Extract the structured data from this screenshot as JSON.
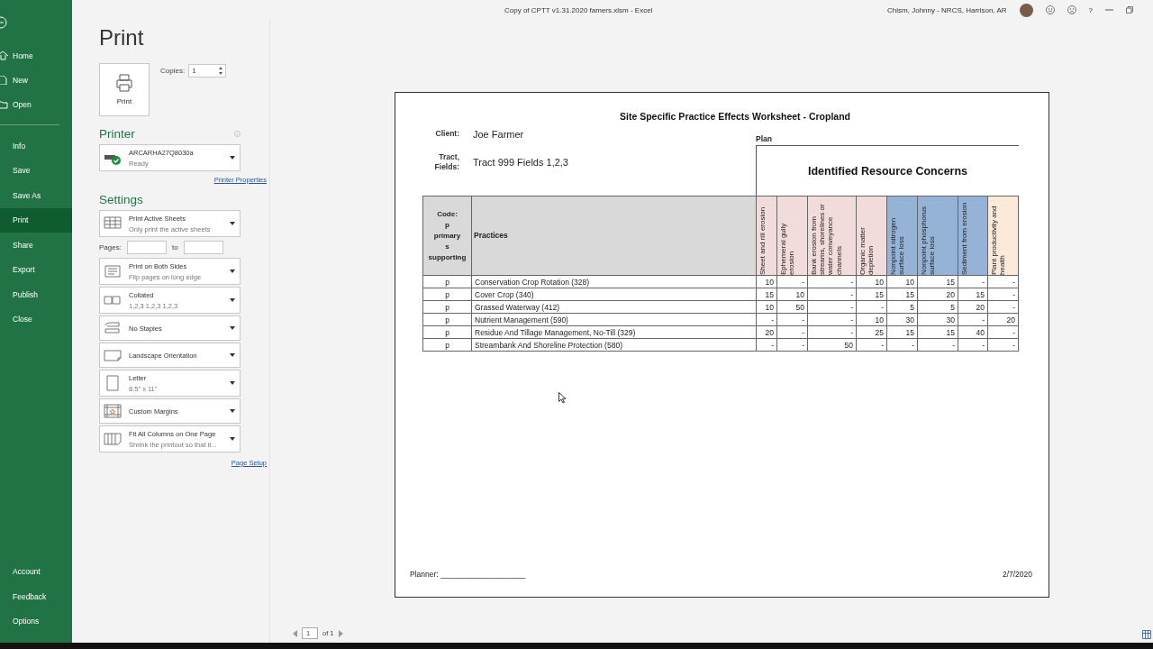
{
  "title_bar": {
    "title": "Copy of CPTT v1.31.2020 famers.xlsm  -  Excel",
    "user": "Chism, Johnny - NRCS, Harrison, AR",
    "help": "?"
  },
  "nav": {
    "items": [
      {
        "label": "Home",
        "kind": "icon",
        "selected": false
      },
      {
        "label": "New",
        "kind": "icon",
        "selected": false
      },
      {
        "label": "Open",
        "kind": "icon",
        "selected": false
      },
      {
        "label": "Info",
        "kind": "plain",
        "selected": false
      },
      {
        "label": "Save",
        "kind": "plain",
        "selected": false
      },
      {
        "label": "Save As",
        "kind": "plain",
        "selected": false
      },
      {
        "label": "Print",
        "kind": "plain",
        "selected": true
      },
      {
        "label": "Share",
        "kind": "plain",
        "selected": false
      },
      {
        "label": "Export",
        "kind": "plain",
        "selected": false
      },
      {
        "label": "Publish",
        "kind": "plain",
        "selected": false
      },
      {
        "label": "Close",
        "kind": "plain",
        "selected": false
      },
      {
        "label": "Account",
        "kind": "footer",
        "selected": false
      },
      {
        "label": "Feedback",
        "kind": "footer",
        "selected": false
      },
      {
        "label": "Options",
        "kind": "footer",
        "selected": false
      }
    ]
  },
  "print_panel": {
    "heading": "Print",
    "print_button": "Print",
    "copies_label": "Copies:",
    "copies": "1",
    "printer_heading": "Printer",
    "printer_name": "ARCARHA27Q8030a",
    "printer_status": "Ready",
    "printer_properties": "Printer Properties",
    "settings_heading": "Settings",
    "settings": [
      {
        "kind": "sheets",
        "title": "Print Active Sheets",
        "subtitle": "Only print the active sheets"
      },
      {
        "kind": "pages",
        "label": "Pages:",
        "to": "to"
      },
      {
        "kind": "duplex",
        "title": "Print on Both Sides",
        "subtitle": "Flip pages on long edge"
      },
      {
        "kind": "collate",
        "title": "Collated",
        "subtitle": "1,2,3    1,2,3    1,2,3"
      },
      {
        "kind": "staples",
        "title": "No Staples"
      },
      {
        "kind": "orientation",
        "title": "Landscape Orientation"
      },
      {
        "kind": "paper",
        "title": "Letter",
        "subtitle": "8.5\" x 11\""
      },
      {
        "kind": "margins",
        "title": "Custom Margins"
      },
      {
        "kind": "scaling",
        "title": "Fit All Columns on One Page",
        "subtitle": "Shrink the printout so that it..."
      }
    ],
    "page_setup": "Page Setup"
  },
  "worksheet": {
    "title": "Site Specific Practice Effects Worksheet - Cropland",
    "client_label": "Client:",
    "client": "Joe Farmer",
    "tract_label": "Tract,\nFields:",
    "tract": "Tract 999 Fields 1,2,3",
    "plan_label": "Plan",
    "concerns_heading": "Identified Resource Concerns",
    "code_header": "Code:\np\nprimary\ns\nsupporting",
    "practices_header": "Practices",
    "columns": [
      {
        "name": "Sheet and rill erosion",
        "color": "#f2dcdb"
      },
      {
        "name": "Ephemeral gully erosion",
        "color": "#f2dcdb"
      },
      {
        "name": "Bank erosion from streams, shorelines or water conveyance channels",
        "color": "#f2dcdb"
      },
      {
        "name": "Organic matter depletion",
        "color": "#f2dcdb"
      },
      {
        "name": "Nonpoint nitrogen surface loss",
        "color": "#95b3d7"
      },
      {
        "name": "Nonpoint phosphorus surface loss",
        "color": "#95b3d7"
      },
      {
        "name": "Sediment from erosion",
        "color": "#95b3d7"
      },
      {
        "name": "Plant productivity and health",
        "color": "#fde9d9"
      }
    ],
    "rows": [
      {
        "code": "p",
        "practice": "Conservation Crop Rotation (328)",
        "values": [
          "10",
          "-",
          "-",
          "10",
          "10",
          "15",
          "-",
          "-"
        ]
      },
      {
        "code": "p",
        "practice": "Cover Crop (340)",
        "values": [
          "15",
          "10",
          "-",
          "15",
          "15",
          "20",
          "15",
          "-"
        ]
      },
      {
        "code": "p",
        "practice": "Grassed Waterway (412)",
        "values": [
          "10",
          "50",
          "-",
          "-",
          "5",
          "5",
          "20",
          "-"
        ]
      },
      {
        "code": "p",
        "practice": "Nutrient Management (590)",
        "values": [
          "-",
          "-",
          "-",
          "10",
          "30",
          "30",
          "-",
          "20"
        ]
      },
      {
        "code": "p",
        "practice": "Residue And Tillage Management, No-Till (329)",
        "values": [
          "20",
          "-",
          "-",
          "25",
          "15",
          "15",
          "40",
          "-"
        ]
      },
      {
        "code": "p",
        "practice": "Streambank And Shoreline Protection (580)",
        "values": [
          "-",
          "-",
          "50",
          "-",
          "-",
          "-",
          "-",
          "-"
        ]
      }
    ],
    "planner": "Planner: ____________________",
    "date": "2/7/2020"
  },
  "pager": {
    "page": "1",
    "of": "of 1"
  }
}
